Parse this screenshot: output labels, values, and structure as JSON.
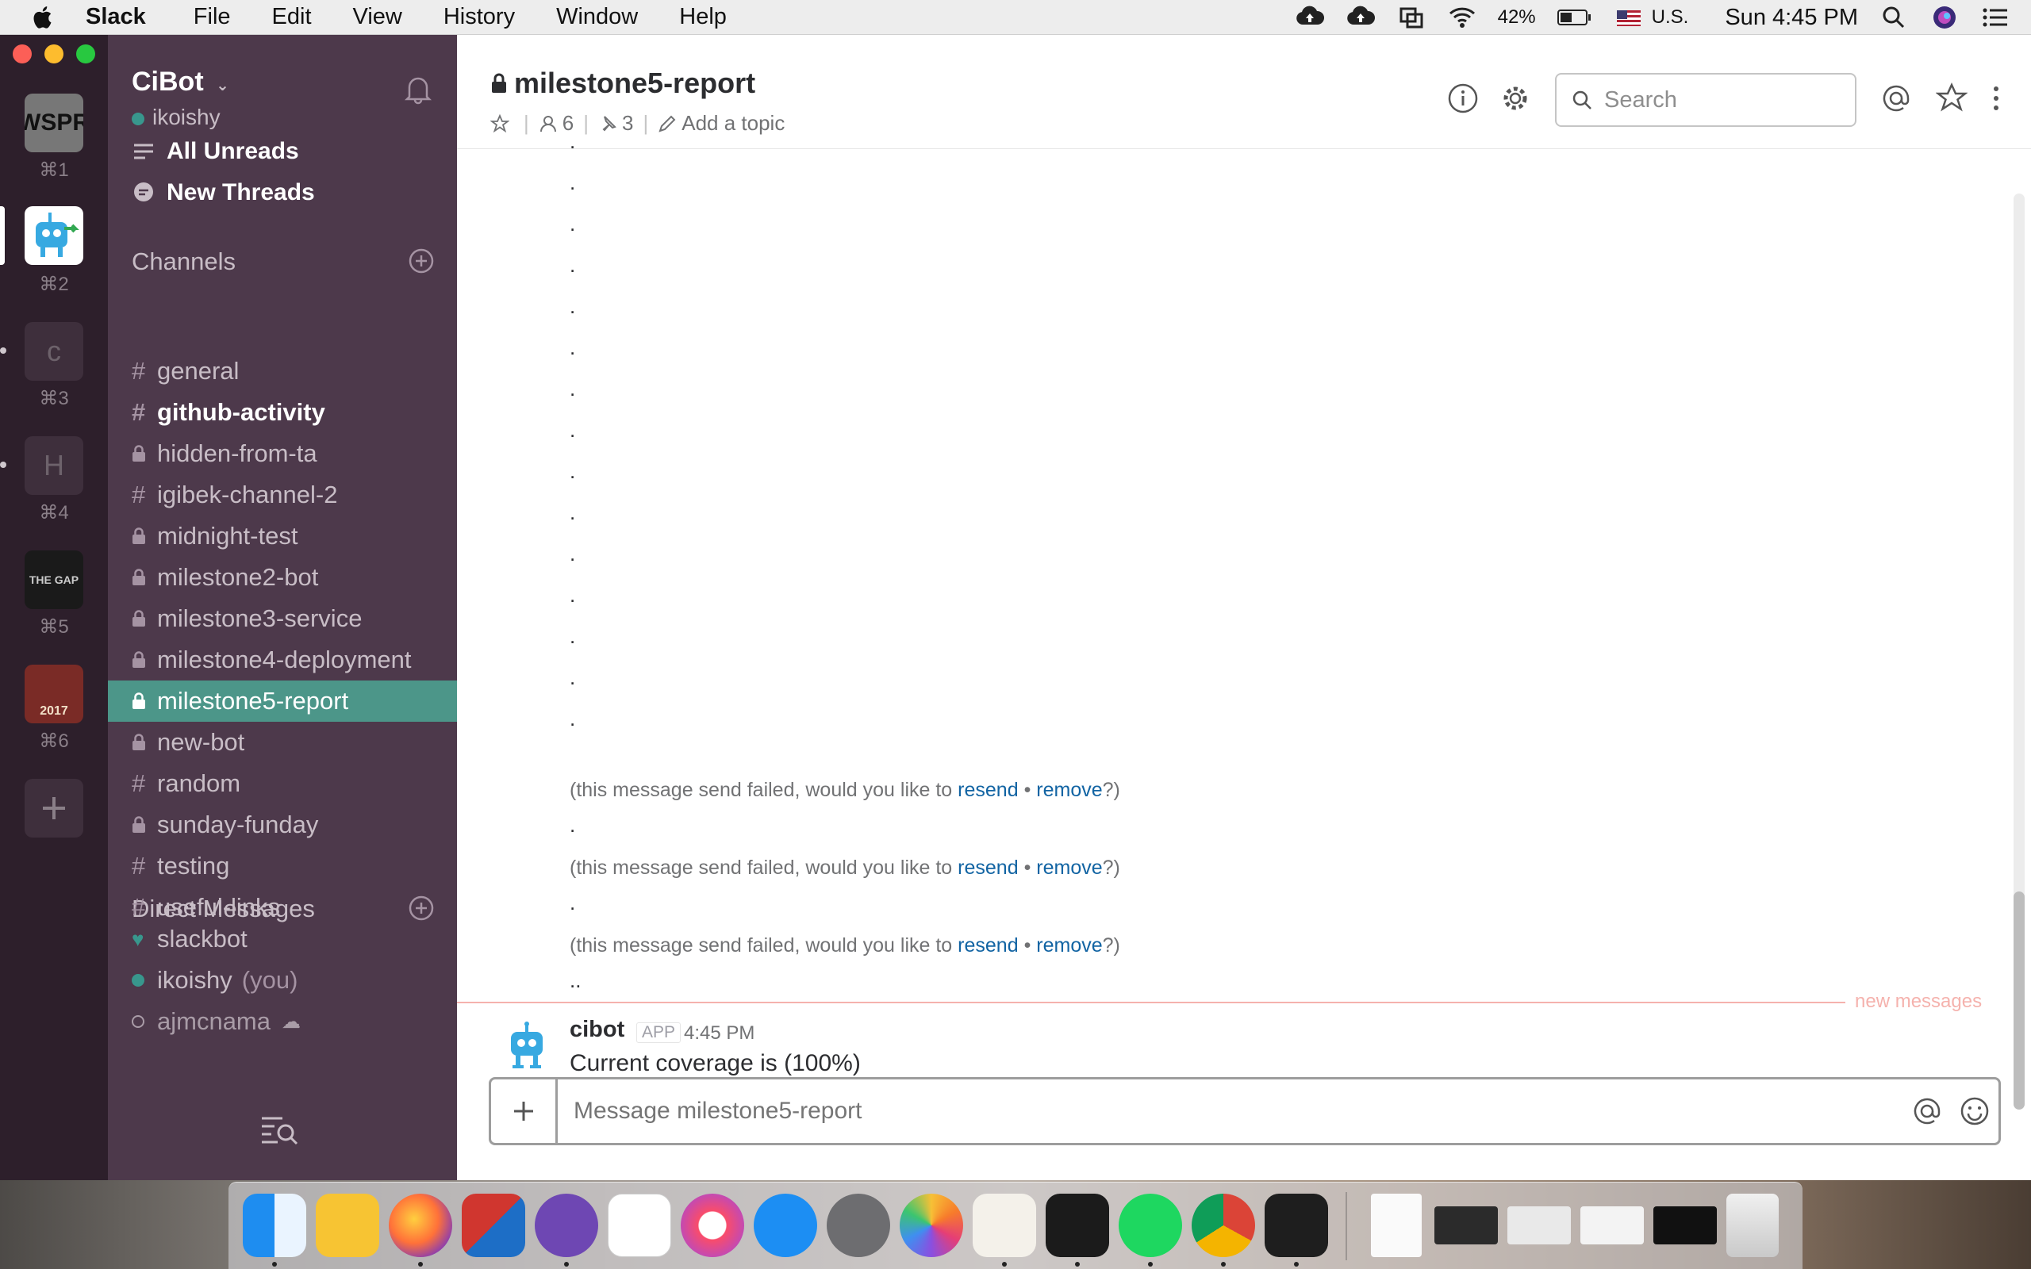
{
  "menubar": {
    "app_name": "Slack",
    "menus": [
      "File",
      "Edit",
      "View",
      "History",
      "Window",
      "Help"
    ],
    "battery": "42%",
    "input_source": "U.S.",
    "clock": "Sun 4:45 PM"
  },
  "teams": [
    {
      "key": "⌘1",
      "label": "WSPR"
    },
    {
      "key": "⌘2",
      "label": ""
    },
    {
      "key": "⌘3",
      "label": "c"
    },
    {
      "key": "⌘4",
      "label": "H"
    },
    {
      "key": "⌘5",
      "label": "THE GAP"
    },
    {
      "key": "⌘6",
      "label": "2017"
    }
  ],
  "sidebar": {
    "workspace": "CiBot",
    "user": "ikoishy",
    "all_unreads": "All Unreads",
    "new_threads": "New Threads",
    "channels_title": "Channels",
    "channels": [
      {
        "name": "general",
        "type": "public"
      },
      {
        "name": "github-activity",
        "type": "public",
        "unread": true
      },
      {
        "name": "hidden-from-ta",
        "type": "private"
      },
      {
        "name": "igibek-channel-2",
        "type": "public"
      },
      {
        "name": "midnight-test",
        "type": "private"
      },
      {
        "name": "milestone2-bot",
        "type": "private"
      },
      {
        "name": "milestone3-service",
        "type": "private"
      },
      {
        "name": "milestone4-deployment",
        "type": "private"
      },
      {
        "name": "milestone5-report",
        "type": "private",
        "active": true
      },
      {
        "name": "new-bot",
        "type": "private"
      },
      {
        "name": "random",
        "type": "public"
      },
      {
        "name": "sunday-funday",
        "type": "private"
      },
      {
        "name": "testing",
        "type": "public"
      },
      {
        "name": "useful-links",
        "type": "public"
      }
    ],
    "dm_title": "Direct Messages",
    "dms": [
      {
        "name": "slackbot",
        "suffix": ""
      },
      {
        "name": "ikoishy",
        "suffix": "(you)"
      },
      {
        "name": "ajmcnama",
        "suffix": ""
      }
    ]
  },
  "header": {
    "channel": "milestone5-report",
    "members": "6",
    "pins": "3",
    "topic_placeholder": "Add a topic",
    "search_placeholder": "Search"
  },
  "messages": {
    "dots": [
      ".",
      ".",
      ".",
      ".",
      ".",
      ".",
      ".",
      ".",
      ".",
      ".",
      ".",
      ".",
      ".",
      ".",
      "."
    ],
    "fail_prefix": "(this message send failed, would you like to",
    "resend": "resend",
    "bullet": "•",
    "remove": "remove",
    "fail_suffix": "?)",
    "between_dots": [
      ".",
      ".",
      ".."
    ],
    "new_messages_label": "new messages",
    "bot": {
      "name": "cibot",
      "badge": "APP",
      "time": "4:45 PM",
      "text": "Current coverage is (100%)"
    }
  },
  "composer": {
    "placeholder": "Message milestone5-report"
  },
  "colors": {
    "sidebar_bg": "#4d394b",
    "team_bar_bg": "#2d1f2b",
    "active_channel": "#4c9689",
    "link": "#1264a3",
    "new_messages": "#f5b2ad"
  }
}
